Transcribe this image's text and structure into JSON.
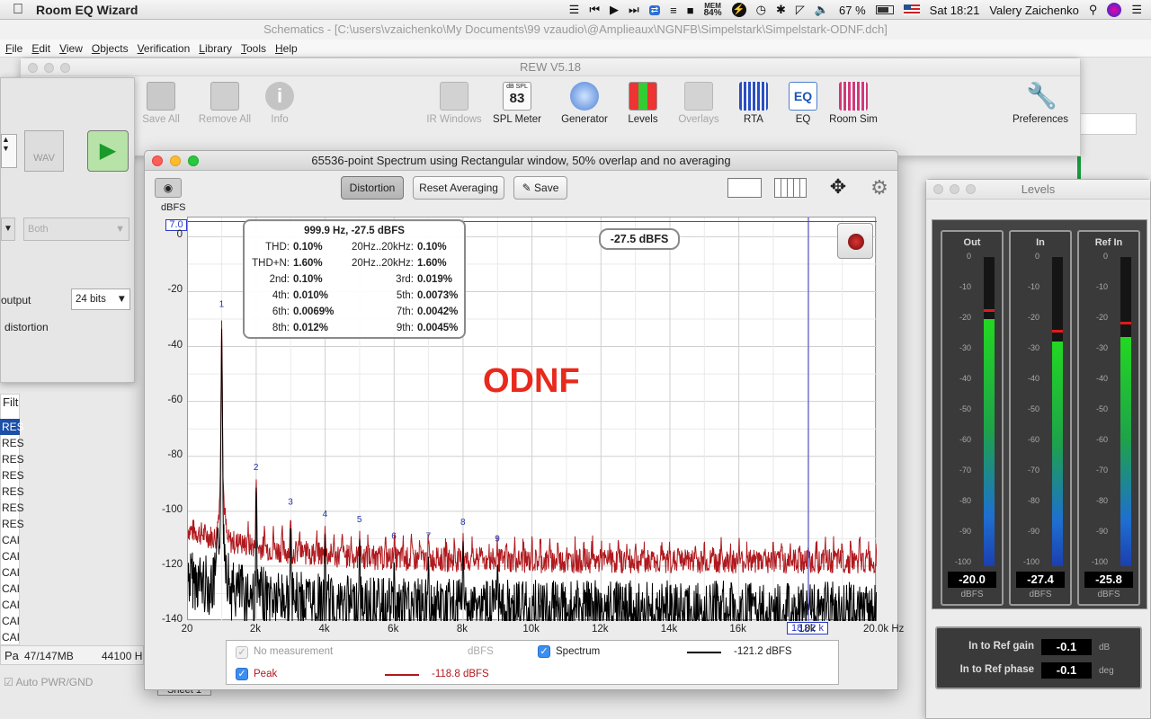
{
  "menubar": {
    "app_name": "Room EQ Wizard",
    "mem_label": "MEM",
    "mem_value": "84%",
    "battery": "67 %",
    "clock": "Sat 18:21",
    "user": "Valery Zaichenko"
  },
  "schematics": {
    "title": "Schematics - [C:\\users\\vzaichenko\\My Documents\\99 vzaudio\\@Amplieaux\\NGNFB\\Simpelstark\\Simpelstark-ODNF.dch]",
    "menu": [
      "File",
      "Edit",
      "View",
      "Objects",
      "Verification",
      "Library",
      "Tools",
      "Help"
    ]
  },
  "rew": {
    "title": "REW V5.18",
    "toolbar": [
      {
        "label": "Save All",
        "icon": "save-all-icon",
        "enabled": false
      },
      {
        "label": "Remove All",
        "icon": "remove-all-icon",
        "enabled": false
      },
      {
        "label": "Info",
        "icon": "info-icon",
        "enabled": false
      },
      {
        "label": "IR Windows",
        "icon": "ir-windows-icon",
        "enabled": false
      },
      {
        "label": "SPL Meter",
        "icon": "spl-meter-icon",
        "enabled": true
      },
      {
        "label": "Generator",
        "icon": "generator-icon",
        "enabled": true
      },
      {
        "label": "Levels",
        "icon": "levels-icon",
        "enabled": true
      },
      {
        "label": "Overlays",
        "icon": "overlays-icon",
        "enabled": false
      },
      {
        "label": "RTA",
        "icon": "rta-icon",
        "enabled": true
      },
      {
        "label": "EQ",
        "icon": "eq-icon",
        "enabled": true
      },
      {
        "label": "Room Sim",
        "icon": "room-sim-icon",
        "enabled": true
      },
      {
        "label": "Preferences",
        "icon": "wrench-icon",
        "enabled": true
      }
    ],
    "spl_badge_top": "dB SPL",
    "spl_badge_value": "83",
    "eq_badge": "EQ"
  },
  "left_dialog": {
    "wav_label": "WAV",
    "channel_value": "Both",
    "output_label": "output",
    "bits_value": "24 bits",
    "distortion_label": "distortion",
    "filter_label": "Filt",
    "list_items": [
      "RES",
      "RES",
      "RES",
      "RES",
      "RES",
      "RES",
      "RES",
      "CAI",
      "CAI",
      "CAI",
      "CAI",
      "CAI",
      "CAI",
      "CAI"
    ],
    "memory": "47/147MB",
    "sample_rate": "44100 H",
    "auto_pwr_label": "Auto PWR/GND",
    "sheet_label": "Sheet 1",
    "pa_label": "Pa"
  },
  "spectrum": {
    "title": "65536-point Spectrum using Rectangular window, 50% overlap and no averaging",
    "buttons": {
      "distortion": "Distortion",
      "reset": "Reset Averaging",
      "save": "Save"
    },
    "y_unit": "dBFS",
    "y_ticks": [
      "0",
      "-20",
      "-40",
      "-60",
      "-80",
      "-100",
      "-120",
      "-140"
    ],
    "x_ticks": [
      "20",
      "2k",
      "4k",
      "6k",
      "8k",
      "10k",
      "12k",
      "14k",
      "16k",
      "18k",
      "20.0k Hz"
    ],
    "y_marker": "7.0",
    "x_cursor": "18.02 k",
    "cursor_readout": "-27.5 dBFS",
    "overlay_text": "ODNF",
    "overlay_color": "#e8291c",
    "info": {
      "header": "999.9 Hz, -27.5 dBFS",
      "rows": [
        {
          "k1": "THD:",
          "v1": "0.10%",
          "k2": "20Hz..20kHz:",
          "v2": "0.10%"
        },
        {
          "k1": "THD+N:",
          "v1": "1.60%",
          "k2": "20Hz..20kHz:",
          "v2": "1.60%"
        },
        {
          "k1": "2nd:",
          "v1": "0.10%",
          "k2": "3rd:",
          "v2": "0.019%"
        },
        {
          "k1": "4th:",
          "v1": "0.010%",
          "k2": "5th:",
          "v2": "0.0073%"
        },
        {
          "k1": "6th:",
          "v1": "0.0069%",
          "k2": "7th:",
          "v2": "0.0042%"
        },
        {
          "k1": "8th:",
          "v1": "0.012%",
          "k2": "9th:",
          "v2": "0.0045%"
        }
      ]
    },
    "harmonic_labels": [
      "1",
      "2",
      "3",
      "4",
      "5",
      "6",
      "7",
      "8",
      "9"
    ],
    "legend": {
      "no_measurement": "No measurement",
      "no_measurement_unit": "dBFS",
      "spectrum": "Spectrum",
      "spectrum_value": "-121.2 dBFS",
      "peak": "Peak",
      "peak_value": "-118.8 dBFS"
    },
    "colors": {
      "peak": "#b0191e",
      "spectrum": "#000000",
      "cursor": "#4848c8",
      "harmonic_label": "#2233aa"
    }
  },
  "chart_data": {
    "type": "line",
    "xlabel": "Hz",
    "ylabel": "dBFS",
    "xlim": [
      20,
      20000
    ],
    "ylim": [
      -140,
      7
    ],
    "grid": true,
    "harmonics": {
      "freq_hz": [
        1000,
        2000,
        3000,
        4000,
        5000,
        6000,
        7000,
        8000,
        9000
      ],
      "level_dbfs": [
        -27.5,
        -87,
        -99.5,
        -104,
        -106,
        -112,
        -112,
        -107,
        -113
      ]
    },
    "series": [
      {
        "name": "Peak",
        "noise_floor_dbfs": -118.8
      },
      {
        "name": "Spectrum",
        "noise_floor_dbfs": -121.2
      }
    ]
  },
  "levels": {
    "title": "Levels",
    "scale": [
      "0",
      "-10",
      "-20",
      "-30",
      "-40",
      "-50",
      "-60",
      "-70",
      "-80",
      "-90",
      "-100"
    ],
    "meters": [
      {
        "name": "Out",
        "value": "-20.0",
        "level": -20.0,
        "peak": -17.0,
        "unit": "dBFS"
      },
      {
        "name": "In",
        "value": "-27.4",
        "level": -27.4,
        "peak": -23.5,
        "unit": "dBFS"
      },
      {
        "name": "Ref In",
        "value": "-25.8",
        "level": -25.8,
        "peak": -21.0,
        "unit": "dBFS"
      }
    ],
    "gain_label": "In to Ref gain",
    "gain_value": "-0.1",
    "gain_unit": "dB",
    "phase_label": "In to Ref phase",
    "phase_value": "-0.1",
    "phase_unit": "deg"
  }
}
